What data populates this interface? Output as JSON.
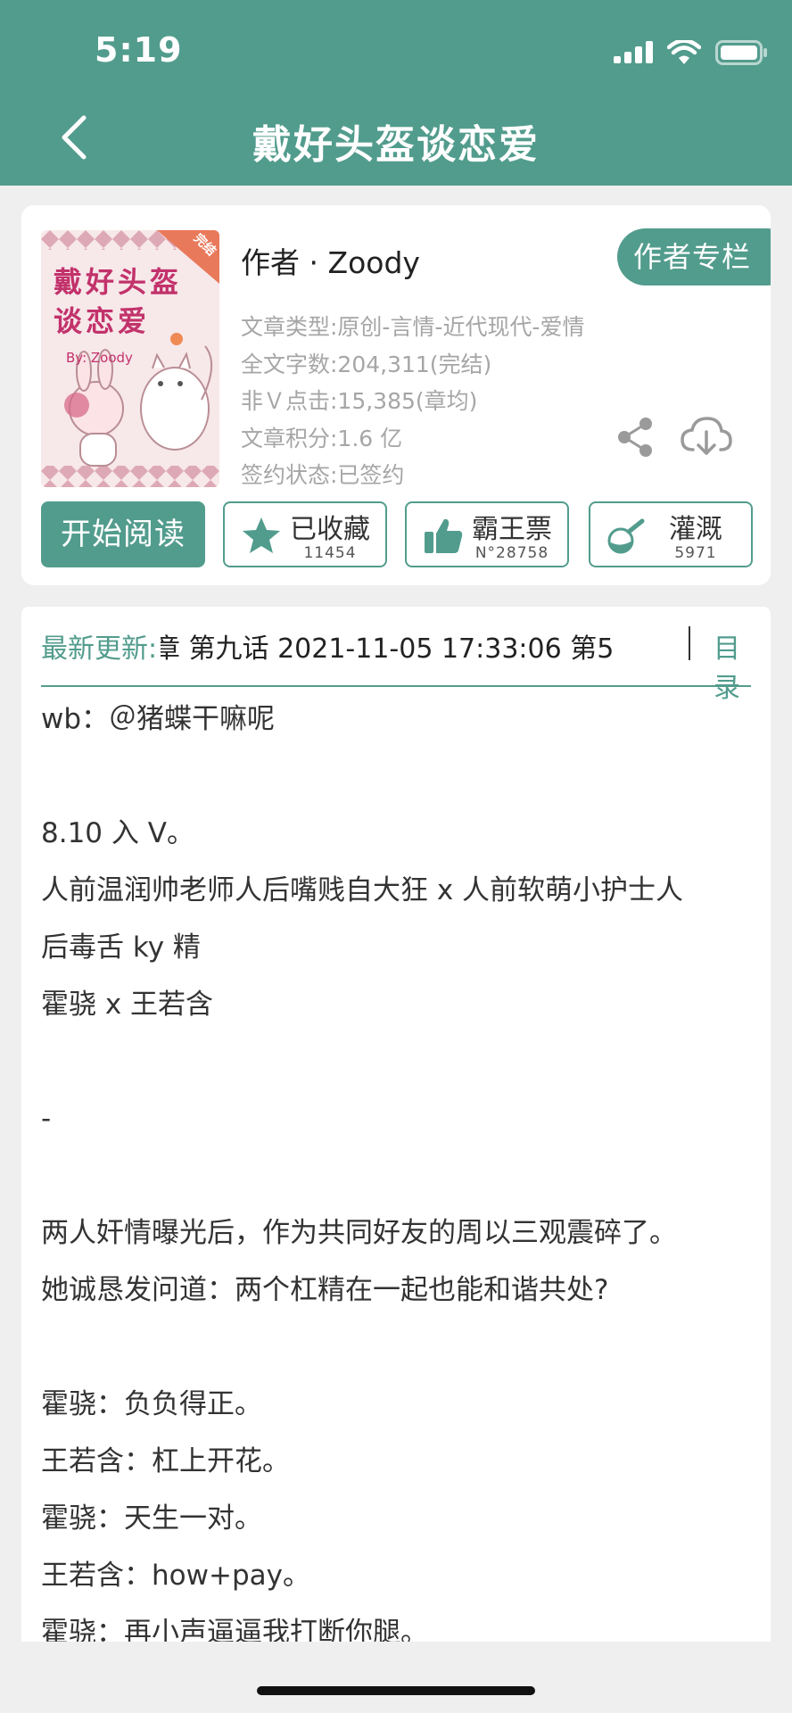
{
  "status_bar": {
    "time": "5:19"
  },
  "nav": {
    "title": "戴好头盔谈恋爱"
  },
  "book": {
    "cover_badge": "完结",
    "cover_title": "戴好头盔谈恋爱",
    "cover_byline": "By: Zoody",
    "author_line": "作者 · Zoody",
    "author_column_button": "作者专栏",
    "meta": [
      "文章类型:原创-言情-近代现代-爱情",
      "全文字数:204,311(完结)",
      "非Ｖ点击:15,385(章均)",
      "文章积分:1.6 亿",
      "签约状态:已签约"
    ]
  },
  "actions": {
    "read_label": "开始阅读",
    "collect": {
      "label": "已收藏",
      "count": "11454"
    },
    "bawangpiao": {
      "label": "霸王票",
      "count": "N°28758"
    },
    "irrigate": {
      "label": "灌溉",
      "count": "5971"
    }
  },
  "latest_update": {
    "label": "最新更新:",
    "text": "章 第九话 2021-11-05 17:33:06  第5",
    "toc_label": "目录"
  },
  "content_lines": [
    "wb：＠猪蝶干嘛呢",
    "",
    "8.10 入 V。",
    "人前温润帅老师人后嘴贱自大狂 x 人前软萌小护士人",
    "后毒舌 ky 精",
    "霍骁 x 王若含",
    "",
    "-",
    "",
    "两人奸情曝光后，作为共同好友的周以三观震碎了。",
    "她诚恳发问道：两个杠精在一起也能和谐共处?",
    "",
    "霍骁：负负得正。",
    "王若含：杠上开花。",
    "霍骁：天生一对。",
    "王若含：how+pay。",
    "霍骁：再小声逼逼我打断你腿。"
  ],
  "colors": {
    "accent": "#529c8d",
    "background": "#efefef"
  }
}
